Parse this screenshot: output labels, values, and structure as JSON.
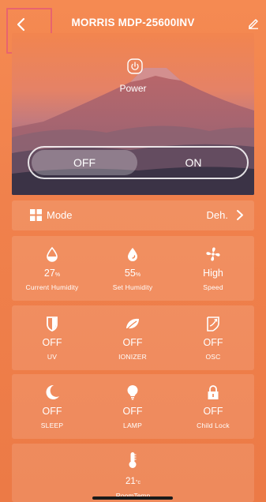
{
  "header": {
    "title": "MORRIS MDP-25600INV",
    "back_icon": "chevron-left-icon",
    "edit_icon": "pencil-icon"
  },
  "power": {
    "label": "Power",
    "icon": "power-icon",
    "off_label": "OFF",
    "on_label": "ON",
    "state": "OFF"
  },
  "mode": {
    "label": "Mode",
    "value": "Deh.",
    "icon": "grid-icon"
  },
  "status_row": [
    {
      "icon": "droplet-outline-icon",
      "value": "27",
      "unit": "%",
      "label": "Current Humidity"
    },
    {
      "icon": "droplet-filled-icon",
      "value": "55",
      "unit": "%",
      "label": "Set Humidity"
    },
    {
      "icon": "fan-icon",
      "value": "High",
      "unit": "",
      "label": "Speed"
    }
  ],
  "function_row_1": [
    {
      "icon": "uv-shield-icon",
      "value": "OFF",
      "label": "UV"
    },
    {
      "icon": "leaf-icon",
      "value": "OFF",
      "label": "IONIZER"
    },
    {
      "icon": "oscillation-icon",
      "value": "OFF",
      "label": "OSC"
    }
  ],
  "function_row_2": [
    {
      "icon": "moon-icon",
      "value": "OFF",
      "label": "SLEEP"
    },
    {
      "icon": "bulb-icon",
      "value": "OFF",
      "label": "LAMP"
    },
    {
      "icon": "lock-icon",
      "value": "OFF",
      "label": "Child Lock"
    }
  ],
  "room_temp": {
    "icon": "thermometer-icon",
    "value": "21",
    "unit": "°c",
    "label": "RoomTemp"
  },
  "colors": {
    "background": "#f2824e",
    "highlight_box": "#e8646e"
  }
}
